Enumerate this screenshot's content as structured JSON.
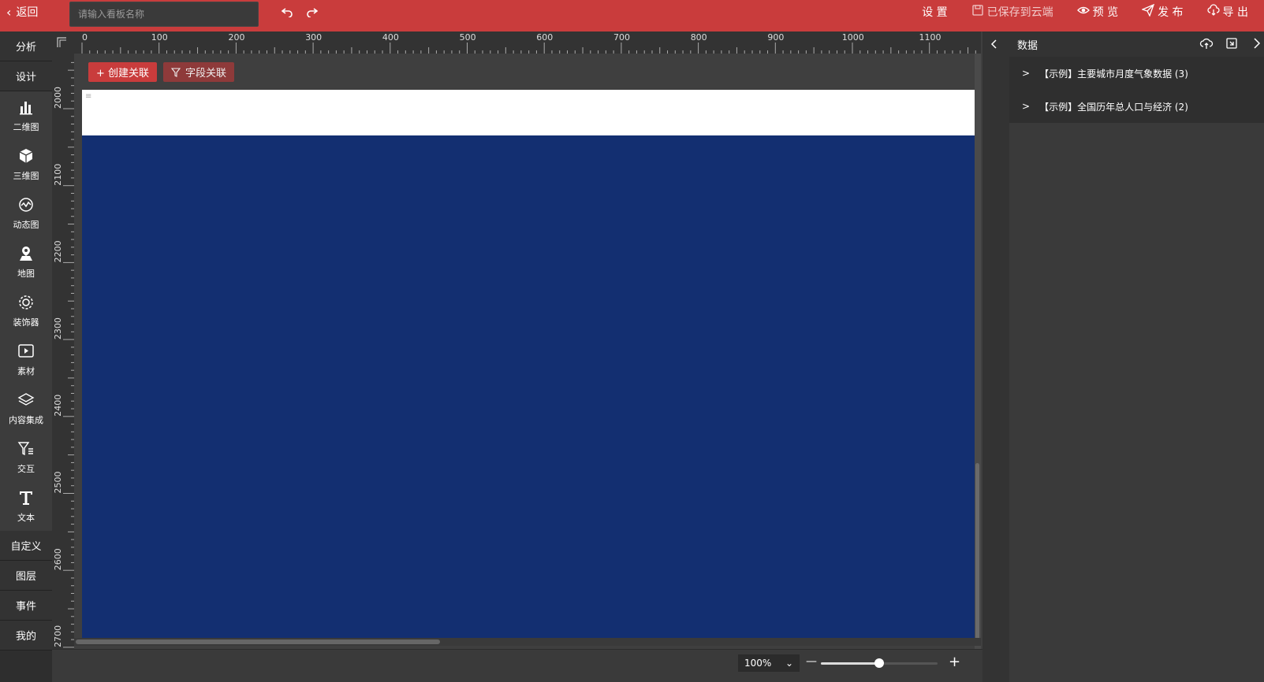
{
  "topbar": {
    "back_label": "返回",
    "name_placeholder": "请输入看板名称",
    "settings_label": "设 置",
    "saved_label": "已保存到云端",
    "preview_label": "预 览",
    "publish_label": "发 布",
    "export_label": "导 出"
  },
  "leftbar": {
    "tabs_top": [
      "分析",
      "设计"
    ],
    "tools": [
      "二维图",
      "三维图",
      "动态图",
      "地图",
      "装饰器",
      "素材",
      "内容集成",
      "交互",
      "文本"
    ],
    "tabs_bottom": [
      "自定义",
      "图层",
      "事件",
      "我的"
    ]
  },
  "canvas": {
    "create_relation": "+ 创建关联",
    "field_relation": "字段关联",
    "ruler_top_labels": [
      "0",
      "100",
      "200",
      "300",
      "400",
      "500",
      "600",
      "700",
      "800",
      "900",
      "1000",
      "1100"
    ],
    "ruler_left_labels": [
      "2000",
      "2100",
      "2200",
      "2300",
      "2400",
      "2500",
      "2600",
      "2700"
    ],
    "background_color": "#132f71"
  },
  "zoom": {
    "value": "100%",
    "slider_fraction": 0.5
  },
  "rightpanel": {
    "title": "数据",
    "datasets": [
      "【示例】主要城市月度气象数据 (3)",
      "【示例】全国历年总人口与经济 (2)"
    ]
  }
}
